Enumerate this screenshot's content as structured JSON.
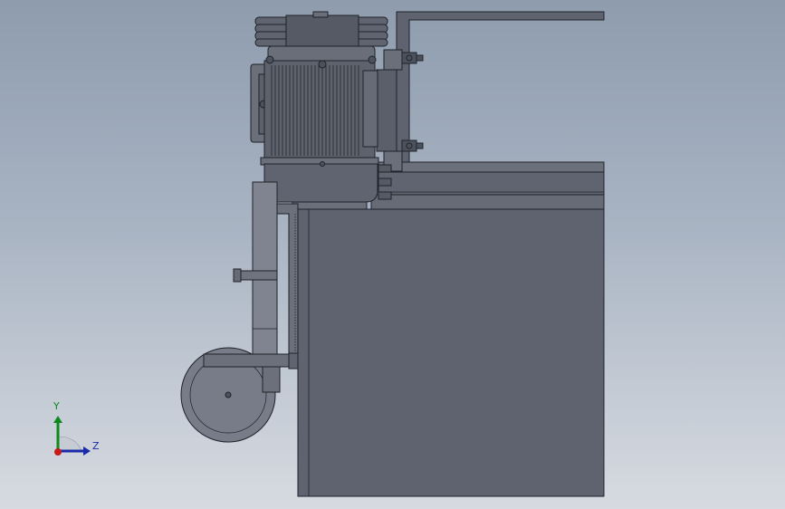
{
  "axis_triad": {
    "y_label": "Y",
    "z_label": "Z",
    "colors": {
      "y": "#0c8a1e",
      "z": "#1a2aa8",
      "x": "#c81818"
    }
  },
  "colors": {
    "background_top": "#8e9cae",
    "background_bottom": "#d7dbe1",
    "body_fill": "#5e636f",
    "edge": "#1f2229",
    "light_part": "#838894"
  }
}
